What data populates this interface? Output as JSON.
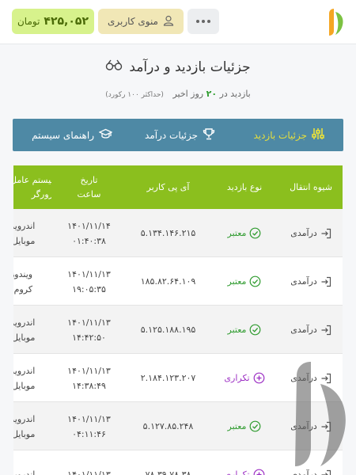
{
  "header": {
    "menu_label": "منوی کاربری",
    "balance_value": "۴۲۵,۰۵۲",
    "balance_unit": "تومان"
  },
  "page": {
    "title": "جزئیات بازدید و درآمد",
    "subtitle_prefix": "بازدید در",
    "subtitle_days": "۲۰",
    "subtitle_suffix": "روز اخیر",
    "subtitle_max": "(حداکثر ۱۰۰ رکورد)"
  },
  "tabs": [
    {
      "label": "جزئیات بازدید",
      "icon": "sliders-icon",
      "active": true
    },
    {
      "label": "جزئیات درآمد",
      "icon": "trophy-icon",
      "active": false
    },
    {
      "label": "راهنمای سیستم",
      "icon": "graduation-cap-icon",
      "active": false
    }
  ],
  "table": {
    "headers": {
      "method": "شیوه انتقال",
      "type": "نوع بازدید",
      "ip": "آی پی کاربر",
      "date_line1": "تاریخ",
      "date_line2": "ساعت",
      "sys_line1": "سیستم عامل",
      "sys_line2": "مرورگر"
    },
    "rows": [
      {
        "method": "درآمدی",
        "type": "معتبر",
        "status": "valid",
        "ip": "۵.۱۳۴.۱۴۶.۲۱۵",
        "date": "۱۴۰۱/۱۱/۱۴",
        "time": "۰۱:۴۰:۳۸",
        "os": "اندروید",
        "browser": "موبایل"
      },
      {
        "method": "درآمدی",
        "type": "معتبر",
        "status": "valid",
        "ip": "۱۸۵.۸۲.۶۴.۱۰۹",
        "date": "۱۴۰۱/۱۱/۱۳",
        "time": "۱۹:۰۵:۳۵",
        "os": "ویندوز",
        "browser": "کروم"
      },
      {
        "method": "درآمدی",
        "type": "معتبر",
        "status": "valid",
        "ip": "۵.۱۲۵.۱۸۸.۱۹۵",
        "date": "۱۴۰۱/۱۱/۱۳",
        "time": "۱۴:۴۲:۵۰",
        "os": "اندروید",
        "browser": "موبایل"
      },
      {
        "method": "درآمدی",
        "type": "تکراری",
        "status": "repeat",
        "ip": "۲.۱۸۴.۱۲۳.۲۰۷",
        "date": "۱۴۰۱/۱۱/۱۳",
        "time": "۱۴:۳۸:۴۹",
        "os": "اندروید",
        "browser": "موبایل"
      },
      {
        "method": "درآمدی",
        "type": "معتبر",
        "status": "valid",
        "ip": "۵.۱۲۷.۸۵.۲۴۸",
        "date": "۱۴۰۱/۱۱/۱۳",
        "time": "۰۴:۱۱:۴۶",
        "os": "اندروید",
        "browser": "موبایل"
      },
      {
        "method": "درآمدی",
        "type": "تکراری",
        "status": "repeat",
        "ip": "۷۸.۳۹.۷۸.۳۸",
        "date": "۱۴۰۱/۱۱/۱۳",
        "time": "",
        "os": "اندروید",
        "browser": ""
      }
    ]
  },
  "colors": {
    "tab_bar": "#4e89a5",
    "table_header": "#8bbf1e",
    "valid": "#2f9b2f",
    "repeat": "#9c2fc4",
    "balance_bg": "#d7f28c",
    "menu_bg": "#f1e7b6"
  }
}
